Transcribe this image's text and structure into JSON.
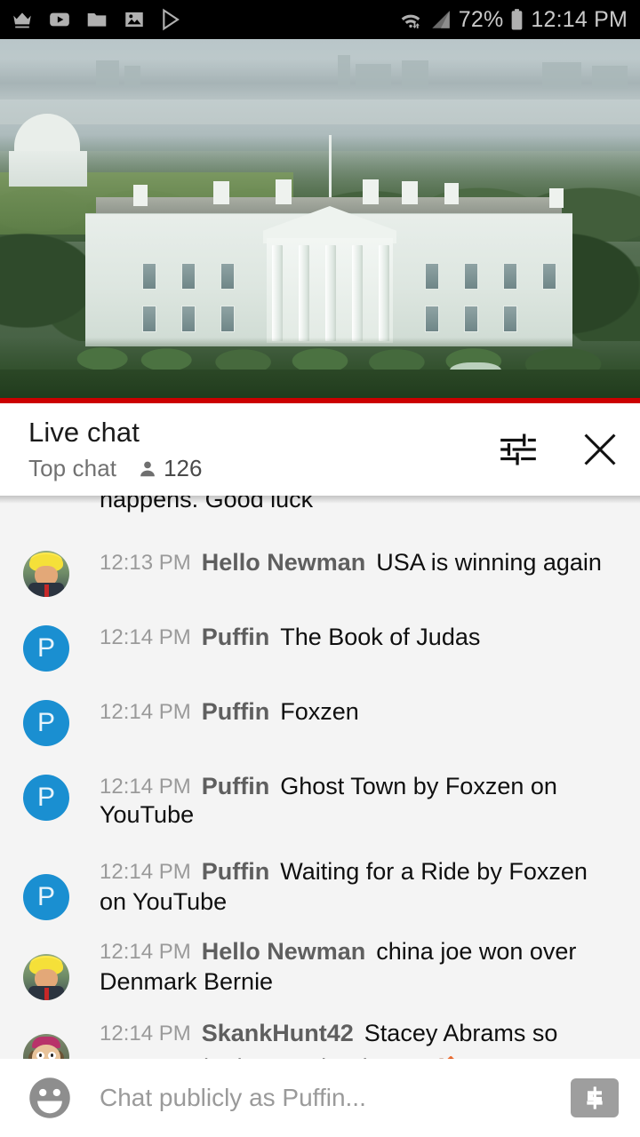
{
  "status_bar": {
    "left_icons": [
      "crown-icon",
      "youtube-icon",
      "folder-icon",
      "photo-icon",
      "play-store-icon"
    ],
    "wifi_icon": "wifi-icon",
    "signal_icon": "cell-signal-icon",
    "battery_percent": "72%",
    "battery_icon": "battery-icon",
    "clock": "12:14 PM"
  },
  "video": {
    "scene_description": "White House aerial view",
    "progress_color": "#cc0000",
    "progress_percent": 100
  },
  "chat_header": {
    "title": "Live chat",
    "mode": "Top chat",
    "viewer_icon": "person-icon",
    "viewer_count": "126",
    "settings_icon": "tune-settings-icon",
    "close_icon": "close-icon"
  },
  "chat": {
    "scrolled_partial_message": "happens. Good luck",
    "messages": [
      {
        "avatar": "trump-caricature-avatar",
        "avatar_type": "image",
        "timestamp": "12:13 PM",
        "author": "Hello Newman",
        "text": "USA is winning again"
      },
      {
        "avatar": "puffin-avatar",
        "avatar_type": "initial",
        "avatar_initial": "P",
        "avatar_color": "#1a8fd1",
        "timestamp": "12:14 PM",
        "author": "Puffin",
        "text": "The Book of Judas"
      },
      {
        "avatar": "puffin-avatar",
        "avatar_type": "initial",
        "avatar_initial": "P",
        "avatar_color": "#1a8fd1",
        "timestamp": "12:14 PM",
        "author": "Puffin",
        "text": "Foxzen"
      },
      {
        "avatar": "puffin-avatar",
        "avatar_type": "initial",
        "avatar_initial": "P",
        "avatar_color": "#1a8fd1",
        "timestamp": "12:14 PM",
        "author": "Puffin",
        "text": "Ghost Town by Foxzen on YouTube"
      },
      {
        "avatar": "puffin-avatar",
        "avatar_type": "initial",
        "avatar_initial": "P",
        "avatar_color": "#1a8fd1",
        "timestamp": "12:14 PM",
        "author": "Puffin",
        "text": "Waiting for a Ride by Foxzen on YouTube"
      },
      {
        "avatar": "trump-caricature-avatar",
        "avatar_type": "image",
        "timestamp": "12:14 PM",
        "author": "Hello Newman",
        "text": "china joe won over Denmark Bernie"
      },
      {
        "avatar": "southpark-character-avatar",
        "avatar_type": "image",
        "timestamp": "12:14 PM",
        "author": "SkankHunt42",
        "text": "Stacey Abrams so nervous she just ate her house ",
        "emoji": "🏠"
      }
    ]
  },
  "input_bar": {
    "emoji_icon": "emoji-smiley-icon",
    "placeholder": "Chat publicly as Puffin...",
    "value": "",
    "superchat_icon": "super-chat-dollar-icon"
  }
}
